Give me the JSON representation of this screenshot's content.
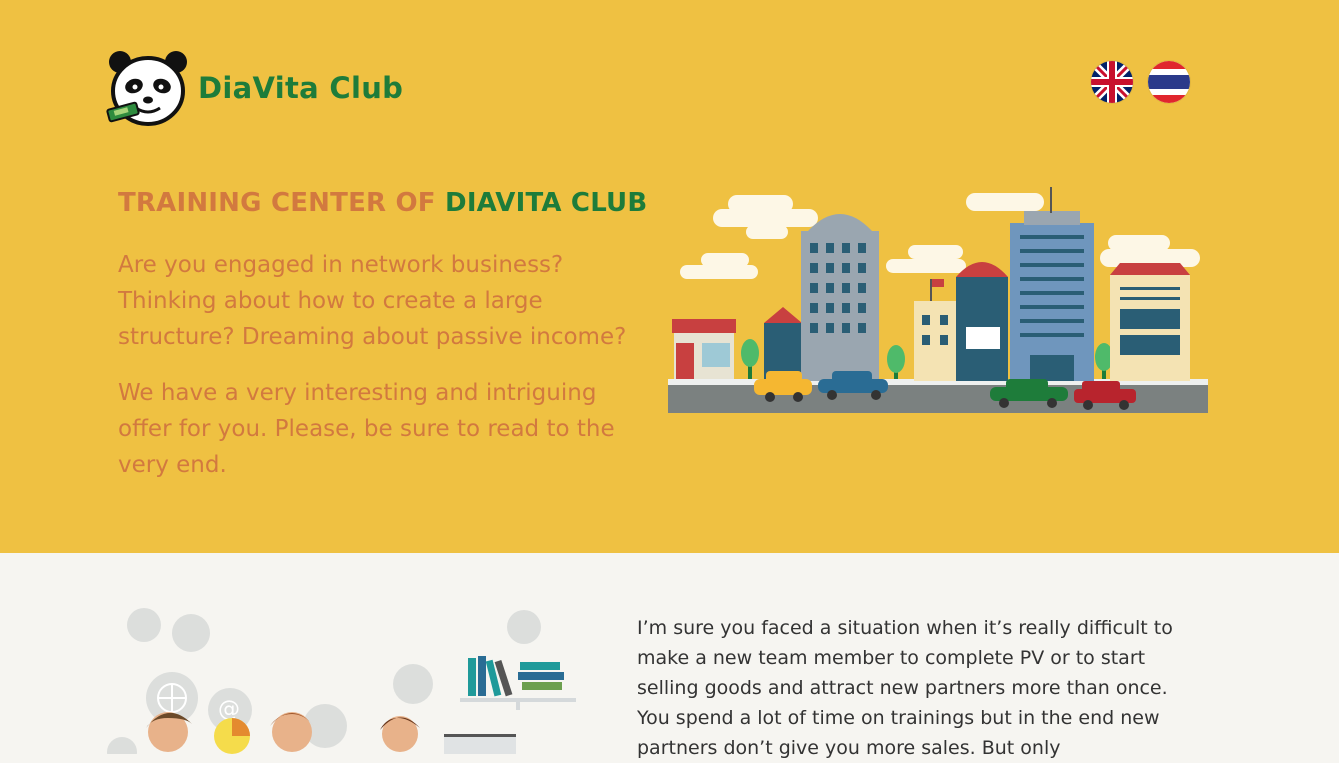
{
  "header": {
    "brand": "DiaVita Club",
    "languages": [
      {
        "code": "en",
        "flag": "uk-flag-icon"
      },
      {
        "code": "th",
        "flag": "thailand-flag-icon"
      }
    ]
  },
  "hero": {
    "title_part1": "TRAINING CENTER OF ",
    "title_part2": "DIAVITA CLUB",
    "paragraph1": "Are you engaged in network business? Thinking about how to create a large structure? Dreaming about passive income?",
    "paragraph2": "We have a very interesting and intriguing offer for you. Please, be sure to read to the very end."
  },
  "section2": {
    "text": "I’m sure you faced a situation when it’s really difficult to make a new team member to complete PV or to start selling goods and attract new partners more than once. You spend a lot of time on trainings but in the end new partners don’t give you more sales. But only"
  },
  "colors": {
    "hero_bg": "#efc142",
    "brand_green": "#1e7c3a",
    "text_orange": "#d2793f",
    "section_bg": "#f6f5f1"
  }
}
